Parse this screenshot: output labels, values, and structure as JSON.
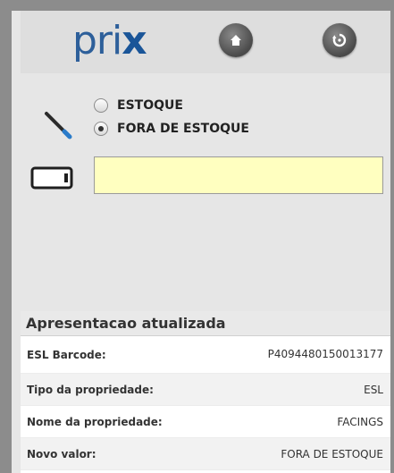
{
  "header": {
    "logo_text_a": "pri",
    "logo_text_b": "x",
    "home_icon": "home-icon",
    "refresh_icon": "refresh-icon"
  },
  "stock_options": [
    {
      "label": "ESTOQUE",
      "selected": false
    },
    {
      "label": "FORA DE ESTOQUE",
      "selected": true
    }
  ],
  "barcode_input": {
    "value": "",
    "placeholder": ""
  },
  "result_panel": {
    "title": "Apresentacao atualizada",
    "rows": [
      {
        "label": "ESL Barcode:",
        "value": "P4094480150013177"
      },
      {
        "label": "Tipo da propriedade:",
        "value": "ESL"
      },
      {
        "label": "Nome da propriedade:",
        "value": "FACINGS"
      },
      {
        "label": "Novo valor:",
        "value": "FORA DE ESTOQUE"
      }
    ]
  },
  "colors": {
    "logo_blue": "#2d5f9a",
    "input_yellow": "#ffffc0",
    "wand_tip": "#2a7bc9"
  }
}
